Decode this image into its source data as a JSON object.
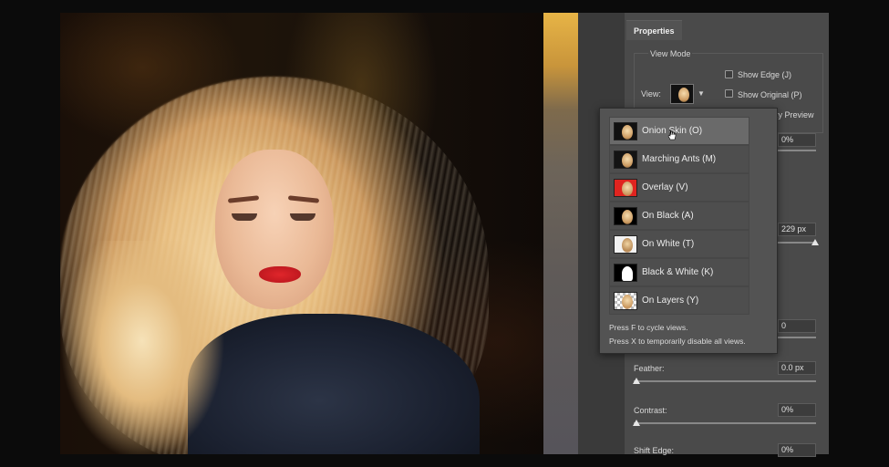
{
  "panel": {
    "tab_label": "Properties",
    "view_mode_label": "View Mode",
    "view_label": "View:",
    "show_edge_label": "Show Edge (J)",
    "show_original_label": "Show Original (P)",
    "quality_preview_partial": "ty Preview",
    "radius_value": "0%",
    "width_value": "229 px",
    "smooth_value": "0",
    "feather_label": "Feather:",
    "feather_value": "0.0 px",
    "contrast_label": "Contrast:",
    "contrast_value": "0%",
    "shift_edge_label": "Shift Edge:",
    "shift_edge_value": "0%"
  },
  "dropdown": {
    "items": [
      {
        "label": "Onion Skin (O)",
        "thumb": "onion"
      },
      {
        "label": "Marching Ants (M)",
        "thumb": "ants"
      },
      {
        "label": "Overlay (V)",
        "thumb": "overlay"
      },
      {
        "label": "On Black (A)",
        "thumb": "black"
      },
      {
        "label": "On White (T)",
        "thumb": "white"
      },
      {
        "label": "Black & White (K)",
        "thumb": "bw"
      },
      {
        "label": "On Layers (Y)",
        "thumb": "layers"
      }
    ],
    "selected_index": 0,
    "hint_1": "Press F to cycle views.",
    "hint_2": "Press X to temporarily disable all views."
  },
  "colors": {
    "panel_bg": "#4a4a4a",
    "dropdown_bg": "#535353",
    "overlay_red": "#e0241f"
  }
}
